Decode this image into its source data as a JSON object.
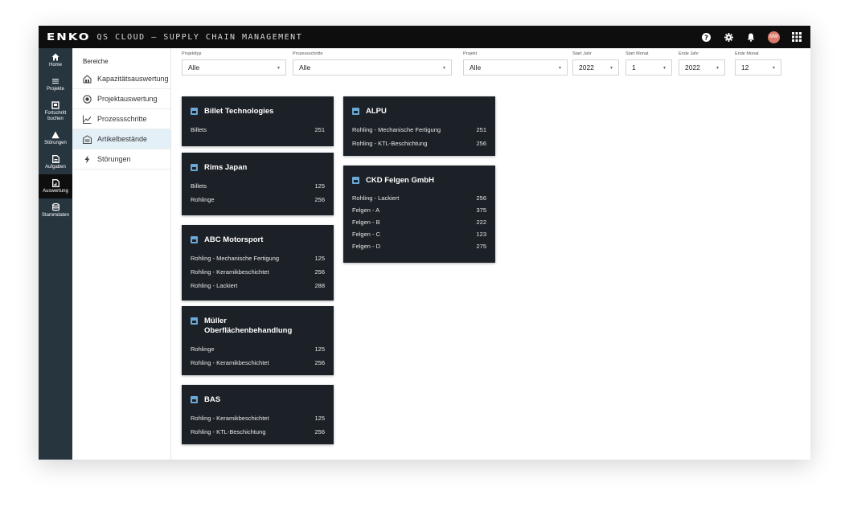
{
  "header": {
    "logo": "ENKO",
    "title": "QS CLOUD – SUPPLY CHAIN MANAGEMENT",
    "avatar_initials": "MW"
  },
  "nav": [
    {
      "label": "Home",
      "icon": "home-icon"
    },
    {
      "label": "Projekte",
      "icon": "list-icon"
    },
    {
      "label": "Fortschritt buchen",
      "icon": "progress-icon"
    },
    {
      "label": "Störungen",
      "icon": "warning-icon"
    },
    {
      "label": "Aufgaben",
      "icon": "task-icon"
    },
    {
      "label": "Auswertung",
      "icon": "report-icon",
      "active": true
    },
    {
      "label": "Stammdaten",
      "icon": "database-icon"
    }
  ],
  "submenu": {
    "heading": "Bereiche",
    "items": [
      {
        "label": "Kapazitätsauswertung",
        "icon": "capacity-icon"
      },
      {
        "label": "Projektauswertung",
        "icon": "target-icon"
      },
      {
        "label": "Prozessschritte",
        "icon": "line-chart-icon"
      },
      {
        "label": "Artikelbestände",
        "icon": "warehouse-icon",
        "active": true
      },
      {
        "label": "Störungen",
        "icon": "bolt-icon"
      }
    ]
  },
  "filters": [
    {
      "label": "Projekttyp",
      "value": "Alle"
    },
    {
      "label": "Prozessschritte",
      "value": "Alle"
    },
    {
      "label": "Projekt",
      "value": "Alle"
    },
    {
      "label": "Start Jahr",
      "value": "2022"
    },
    {
      "label": "Start Monat",
      "value": "1"
    },
    {
      "label": "Ende Jahr",
      "value": "2022"
    },
    {
      "label": "Ende Monat",
      "value": "12"
    }
  ],
  "cards": [
    {
      "title": "Billet Technologies",
      "rows": [
        {
          "name": "Billets",
          "value": "251"
        }
      ]
    },
    {
      "title": "Rims Japan",
      "rows": [
        {
          "name": "Billets",
          "value": "125"
        },
        {
          "name": "Rohlinge",
          "value": "256"
        }
      ]
    },
    {
      "title": "ABC Motorsport",
      "rows": [
        {
          "name": "Rohling - Mechanische Fertigung",
          "value": "125"
        },
        {
          "name": "Rohling - Keramikbeschichtet",
          "value": "256"
        },
        {
          "name": "Rohling - Lackiert",
          "value": "288"
        }
      ]
    },
    {
      "title": "Müller Oberflächenbehandlung",
      "rows": [
        {
          "name": "Rohlinge",
          "value": "125"
        },
        {
          "name": "Rohling - Keramikbeschichtet",
          "value": "256"
        }
      ]
    },
    {
      "title": "BAS",
      "rows": [
        {
          "name": "Rohling - Keramikbeschichtet",
          "value": "125"
        },
        {
          "name": "Rohling - KTL-Beschichtung",
          "value": "256"
        }
      ]
    },
    {
      "title": "ALPU",
      "rows": [
        {
          "name": "Rohling - Mechanische Fertigung",
          "value": "251"
        },
        {
          "name": "Rohling - KTL-Beschichtung",
          "value": "256"
        }
      ]
    },
    {
      "title": "CKD Felgen GmbH",
      "rows": [
        {
          "name": "Rohling - Lackiert",
          "value": "256"
        },
        {
          "name": "Felgen - A",
          "value": "375"
        },
        {
          "name": "Felgen - B",
          "value": "222"
        },
        {
          "name": "Felgen - C",
          "value": "123"
        },
        {
          "name": "Felgen - D",
          "value": "275"
        }
      ]
    }
  ]
}
